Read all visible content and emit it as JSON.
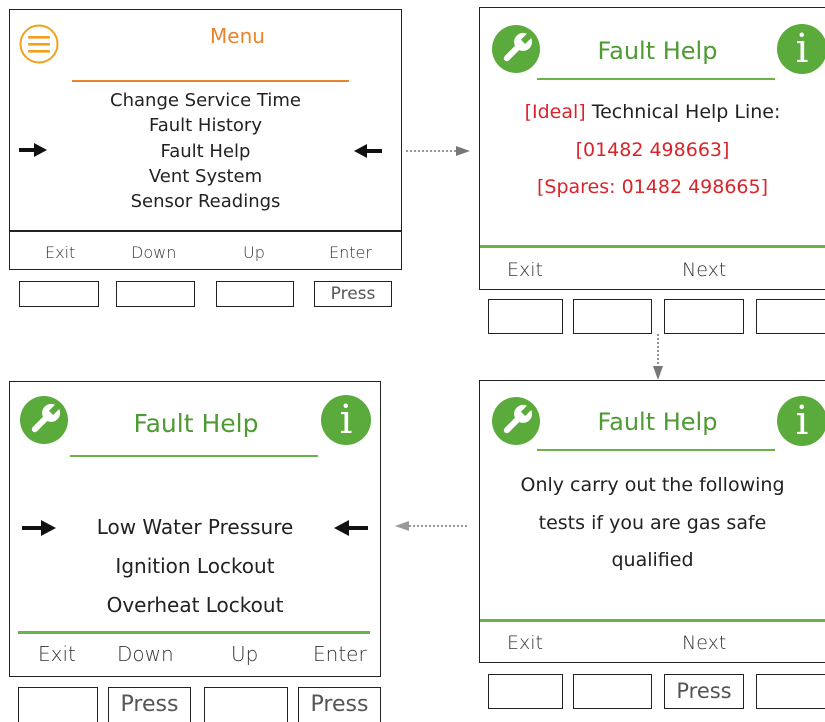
{
  "colors": {
    "green": "#5aaa3c",
    "orange": "#e8842a",
    "red": "#d9242b",
    "line_green": "#6ab344",
    "line_orange": "#e8842a"
  },
  "screen1": {
    "title": "Menu",
    "icon": "hamburger-menu-icon",
    "items": [
      "Change Service Time",
      "Fault History",
      "Fault Help",
      "Vent System",
      "Sensor Readings"
    ],
    "selected_index": 2,
    "softkeys": [
      "Exit",
      "Down",
      "Up",
      "Enter"
    ],
    "buttons": [
      "",
      "",
      "",
      "Press"
    ]
  },
  "screen2": {
    "title": "Fault Help",
    "icons": [
      "wrench-icon",
      "info-icon"
    ],
    "info_glyph": "i",
    "line1_bracket": "[Ideal]",
    "line1_text": " Technical Help Line:",
    "line2": "[01482 498663]",
    "line3": "[Spares: 01482 498665]",
    "softkeys": [
      "Exit",
      "Next"
    ],
    "buttons": [
      "",
      "",
      "",
      ""
    ]
  },
  "screen3": {
    "title": "Fault Help",
    "icons": [
      "wrench-icon",
      "info-icon"
    ],
    "info_glyph": "i",
    "lines": [
      "Only carry out the following",
      "tests if you are gas safe",
      "qualified"
    ],
    "softkeys": [
      "Exit",
      "Next"
    ],
    "buttons": [
      "",
      "",
      "Press",
      ""
    ]
  },
  "screen4": {
    "title": "Fault Help",
    "icons": [
      "wrench-icon",
      "info-icon"
    ],
    "info_glyph": "i",
    "items": [
      "Low Water Pressure",
      "Ignition Lockout",
      "Overheat Lockout"
    ],
    "selected_index": 0,
    "softkeys": [
      "Exit",
      "Down",
      "Up",
      "Enter"
    ],
    "buttons": [
      "",
      "Press",
      "",
      "Press"
    ]
  }
}
